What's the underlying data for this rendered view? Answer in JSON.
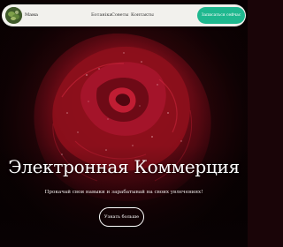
{
  "navbar": {
    "avatar_icon": "plant-avatar-icon",
    "brand": "Мама",
    "links": [
      "Ботаніка",
      "Советы",
      "Контакты"
    ],
    "cta": "Записаться сейчас"
  },
  "hero": {
    "title": "Электронная Коммерция",
    "subtitle": "Прокачай свои навыки и зарабатывай на своих увлечениях!",
    "button": "Узнать больше"
  },
  "colors": {
    "accent": "#1fb88f",
    "navbar_bg": "#f2f1ed",
    "hero_dark": "#1a0508",
    "rose": "#8e0f1c"
  }
}
